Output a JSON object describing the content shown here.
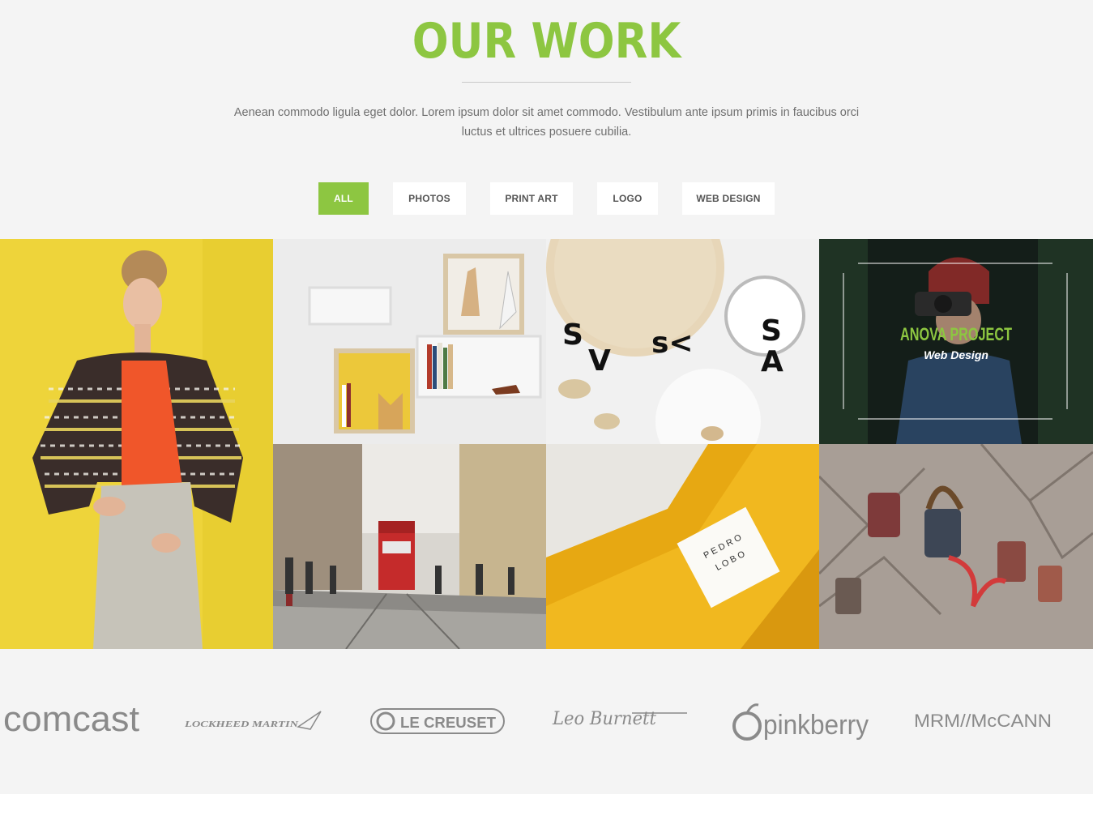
{
  "header": {
    "title": "OUR WORK",
    "intro": "Aenean commodo ligula eget dolor. Lorem ipsum dolor sit amet commodo. Vestibulum ante ipsum primis in faucibus orci luctus et ultrices posuere cubilia."
  },
  "filters": [
    {
      "label": "ALL",
      "active": true
    },
    {
      "label": "PHOTOS",
      "active": false
    },
    {
      "label": "PRINT ART",
      "active": false
    },
    {
      "label": "LOGO",
      "active": false
    },
    {
      "label": "WEB DESIGN",
      "active": false
    }
  ],
  "portfolio": {
    "featured": {
      "title": "ANOVA PROJECT",
      "subtitle": "Web Design"
    },
    "shelf_text": "SV SA"
  },
  "clients": [
    {
      "name": "comcast"
    },
    {
      "name": "LOCKHEED MARTIN"
    },
    {
      "name": "LE CREUSET"
    },
    {
      "name": "Leo Burnett"
    },
    {
      "name": "pinkberry"
    },
    {
      "name": "MRM//McCANN"
    }
  ],
  "colors": {
    "accent": "#8dc641",
    "background": "#f4f4f4",
    "logo_gray": "#8a8a8a"
  }
}
